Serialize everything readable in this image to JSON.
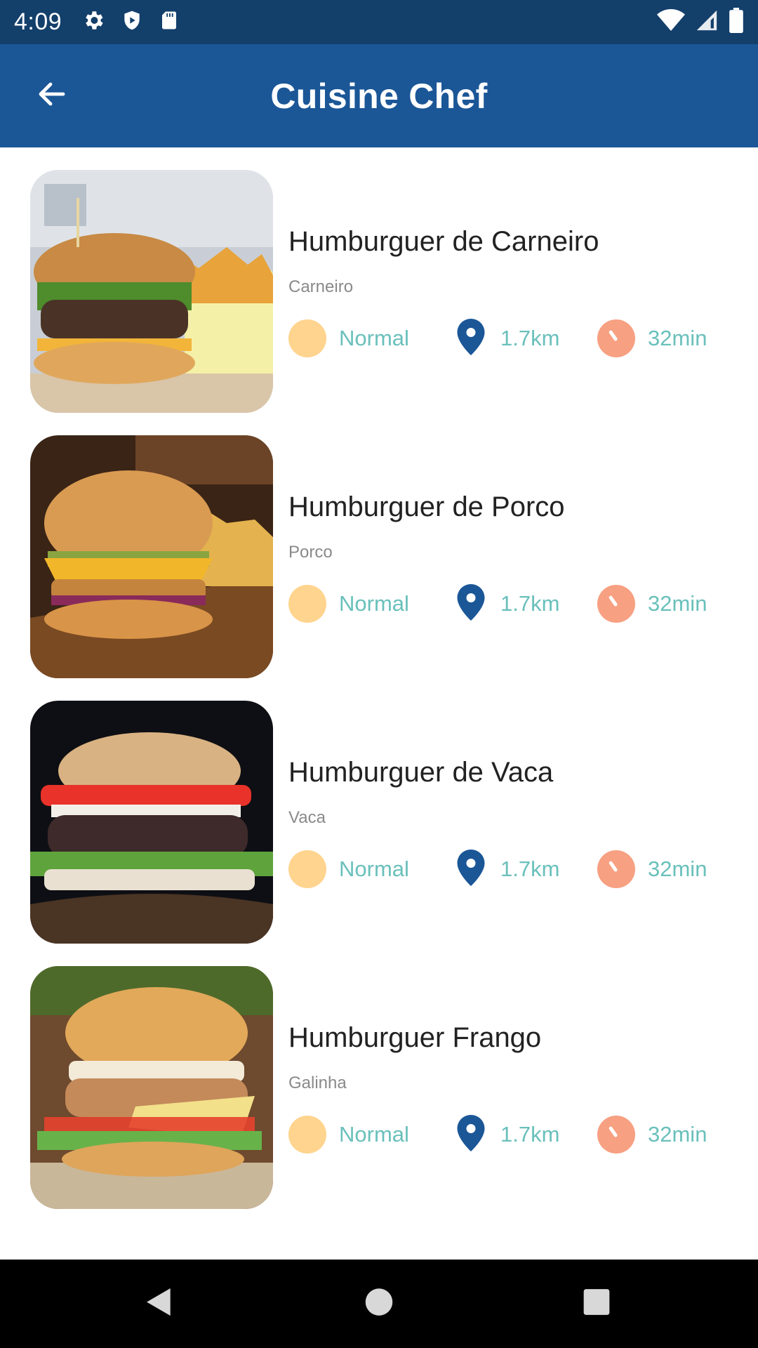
{
  "status_bar": {
    "time": "4:09",
    "left_icons": [
      "gear-icon",
      "shield-icon",
      "sd-card-icon"
    ],
    "right_icons": [
      "wifi-icon",
      "signal-icon",
      "battery-icon"
    ]
  },
  "app_bar": {
    "title": "Cuisine Chef",
    "back_icon": "arrow-back-icon",
    "background": "#1b5797"
  },
  "items": [
    {
      "title": "Humburguer de Carneiro",
      "subtitle": "Carneiro",
      "level": "Normal",
      "distance": "1.7km",
      "time": "32min"
    },
    {
      "title": "Humburguer de Porco",
      "subtitle": "Porco",
      "level": "Normal",
      "distance": "1.7km",
      "time": "32min"
    },
    {
      "title": "Humburguer de Vaca",
      "subtitle": "Vaca",
      "level": "Normal",
      "distance": "1.7km",
      "time": "32min"
    },
    {
      "title": "Humburguer Frango",
      "subtitle": "Galinha",
      "level": "Normal",
      "distance": "1.7km",
      "time": "32min"
    }
  ],
  "colors": {
    "meta_text": "#6ac0bb",
    "level_dot": "#ffd48e",
    "clock": "#f7a082",
    "pin": "#1b5797"
  },
  "nav_bar": {
    "icons": [
      "back-triangle-icon",
      "home-circle-icon",
      "recents-square-icon"
    ]
  }
}
